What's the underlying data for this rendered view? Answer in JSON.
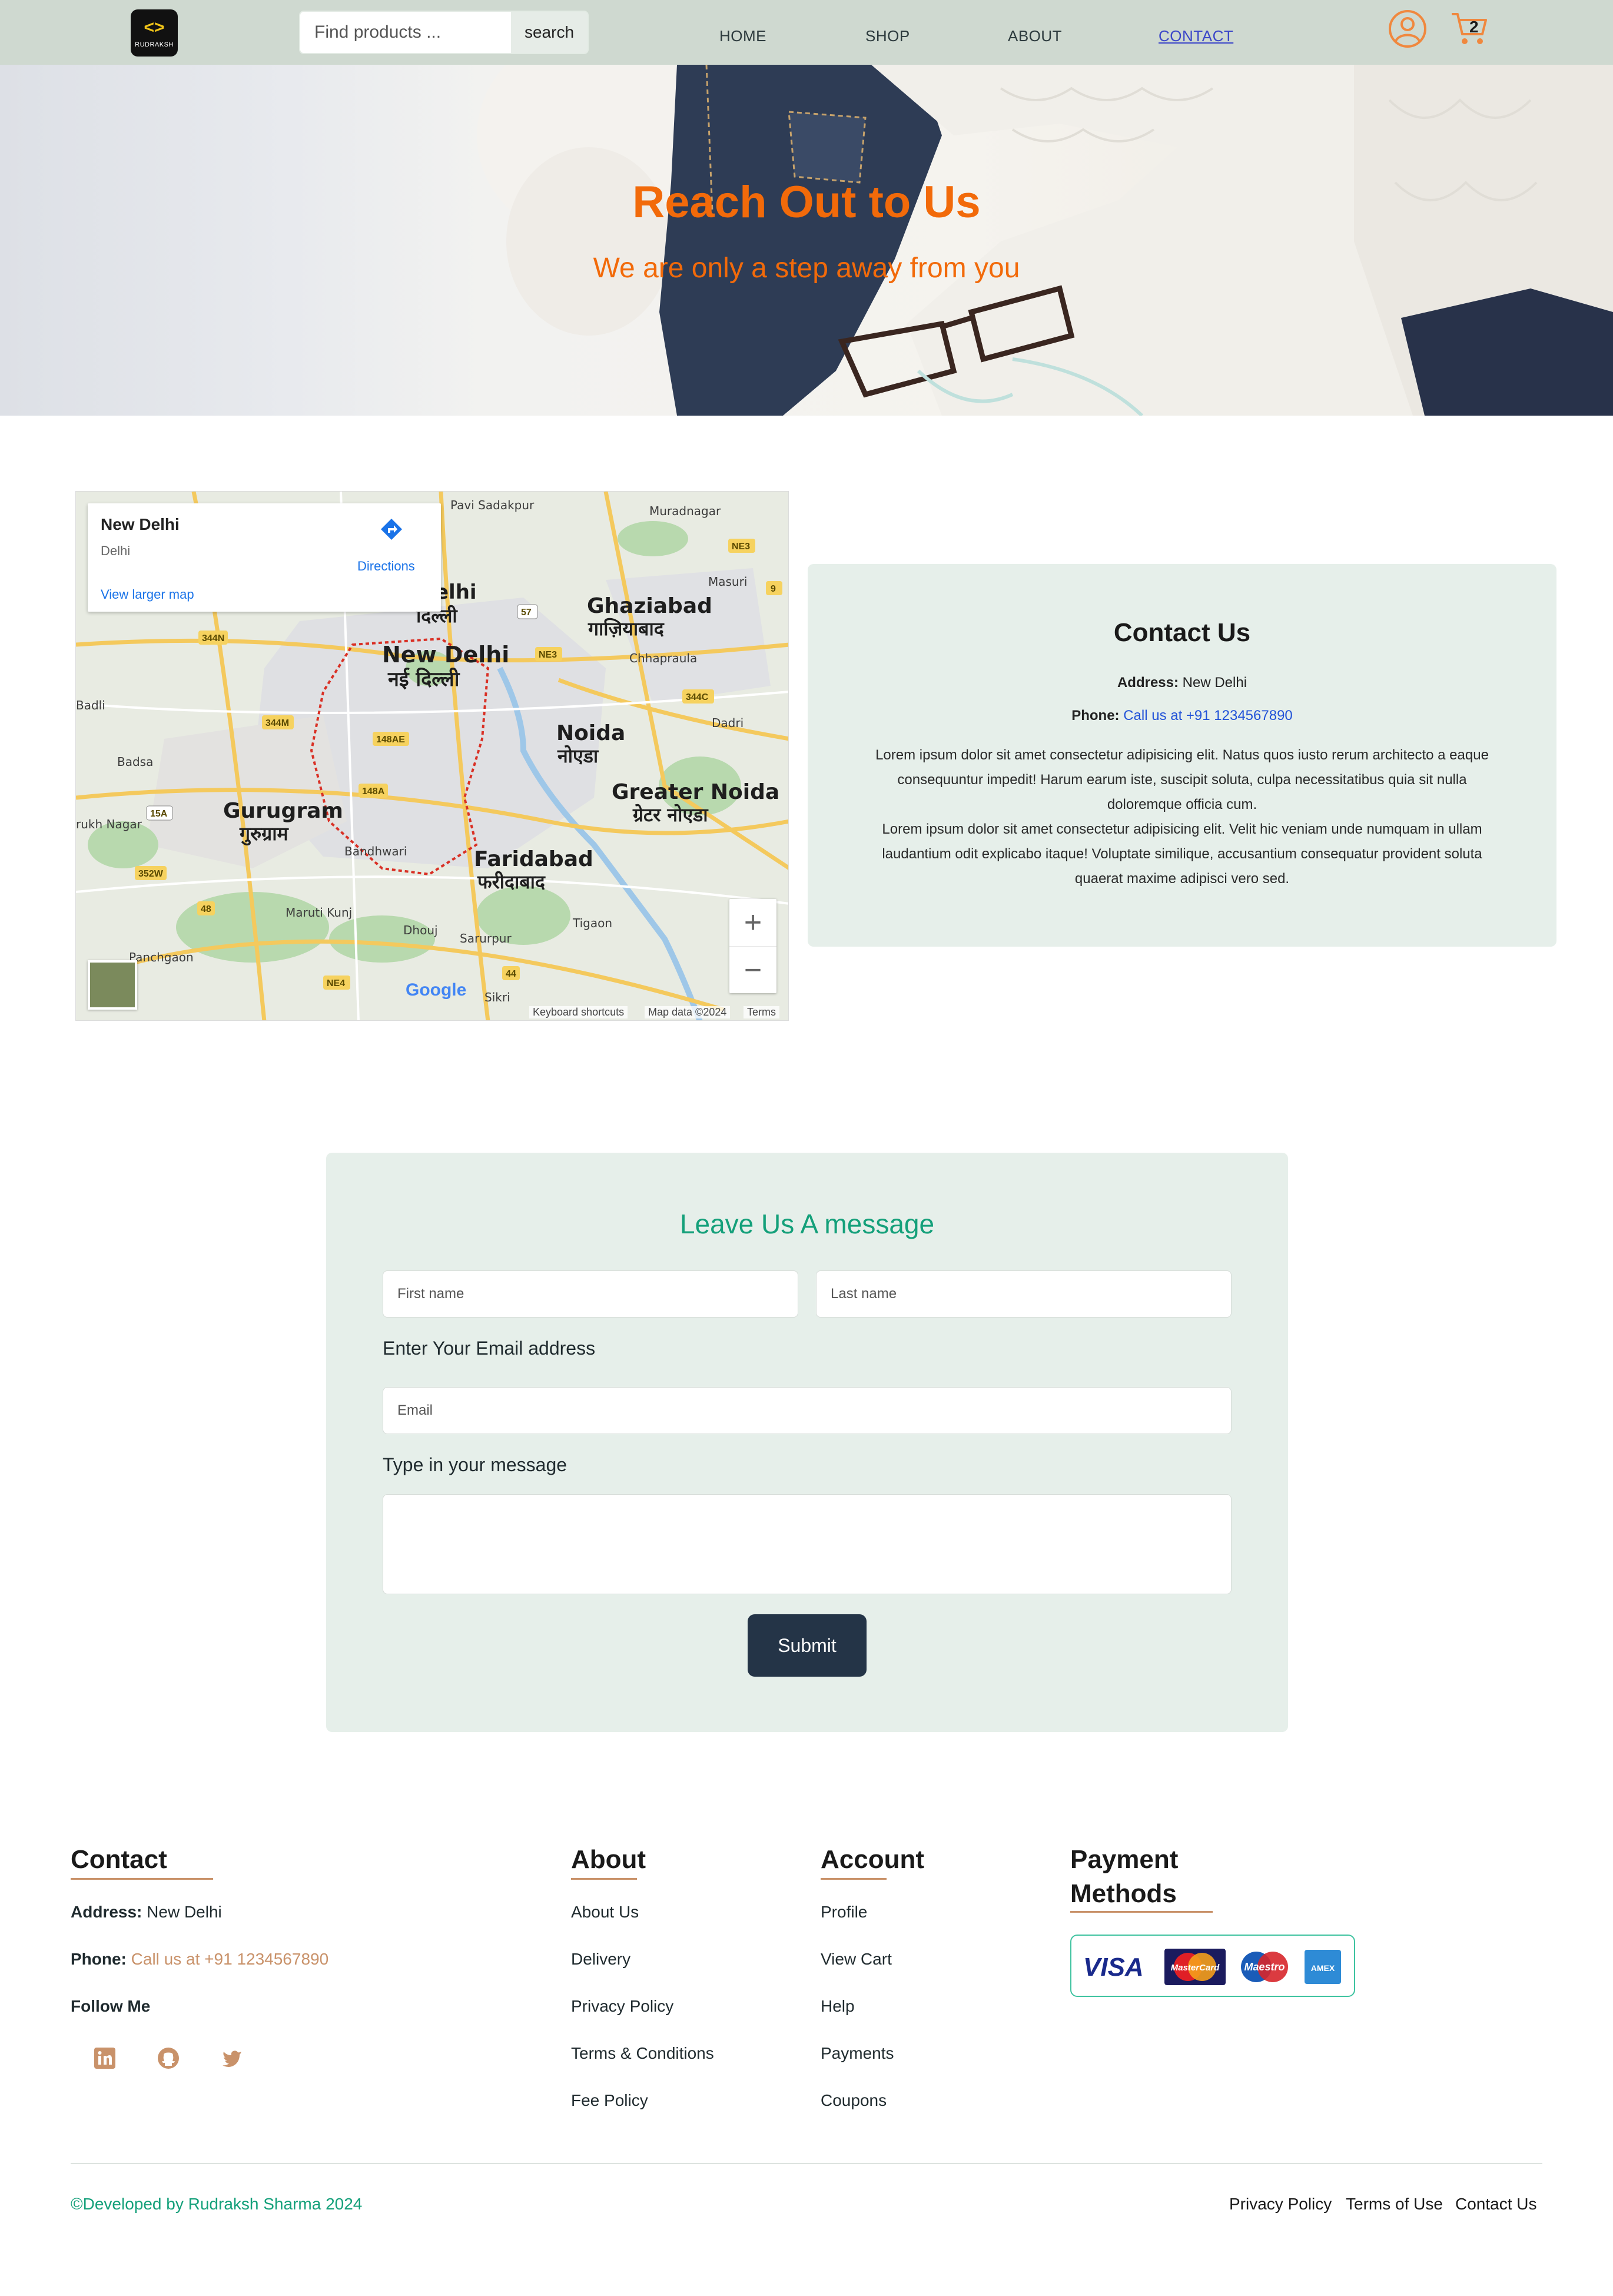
{
  "brand": {
    "logo_glyph": "<>",
    "logo_text": "RUDRAKSH"
  },
  "search": {
    "placeholder": "Find products ...",
    "button_label": "search"
  },
  "nav": {
    "items": [
      {
        "label": "HOME"
      },
      {
        "label": "SHOP"
      },
      {
        "label": "ABOUT"
      },
      {
        "label": "CONTACT",
        "active": true
      }
    ],
    "cart_count": "2"
  },
  "hero": {
    "title": "Reach Out to Us",
    "subtitle": "We are only a step away from you"
  },
  "map": {
    "place_name": "New Delhi",
    "place_sub": "Delhi",
    "directions_label": "Directions",
    "view_larger_label": "View larger map",
    "zoom_in": "+",
    "zoom_out": "−",
    "google_label": "Google",
    "footer": {
      "shortcuts": "Keyboard shortcuts",
      "map_data": "Map data ©2024",
      "terms": "Terms"
    },
    "labels": {
      "delhi": "New Delhi",
      "delhi_hi": "नई दिल्ली",
      "ghaziabad": "Ghaziabad",
      "ghaziabad_hi": "गाज़ियाबाद",
      "noida": "Noida",
      "noida_hi": "नोएडा",
      "greater_noida": "Greater Noida",
      "greater_noida_hi": "ग्रेटर नोएडा",
      "gurugram": "Gurugram",
      "gurugram_hi": "गुरुग्राम",
      "faridabad": "Faridabad",
      "faridabad_hi": "फरीदाबाद",
      "pavi_sadakpur": "Pavi Sadakpur",
      "muradnagar": "Muradnagar",
      "masuri": "Masuri",
      "chhapraula": "Chhapraula",
      "dadri": "Dadri",
      "badli": "Badli",
      "badsa": "Badsa",
      "rukh_nagar": "rukh Nagar",
      "bandhwari": "Bandhwari",
      "maruti_kunj": "Maruti Kunj",
      "dhouj": "Dhouj",
      "sarurpur": "Sarurpur",
      "tigaon": "Tigaon",
      "sikri": "Sikri",
      "panchgaon": "Panchgaon",
      "delhi_top": "elhi",
      "delhi_top_hi": "दिल्ली"
    },
    "road_badges": [
      "344N",
      "NE3",
      "57",
      "NE3",
      "9",
      "344M",
      "148AE",
      "148A",
      "15A",
      "352W",
      "48",
      "344C",
      "NE4",
      "44"
    ]
  },
  "contact_card": {
    "title": "Contact Us",
    "address_label": "Address:",
    "address_value": "New Delhi",
    "phone_label": "Phone:",
    "phone_value": "Call us at +91 1234567890",
    "body_1": "Lorem ipsum dolor sit amet consectetur adipisicing elit. Natus quos iusto rerum architecto a eaque consequuntur impedit! Harum earum iste, suscipit soluta, culpa necessitatibus quia sit nulla doloremque officia cum.",
    "body_2": "Lorem ipsum dolor sit amet consectetur adipisicing elit. Velit hic veniam unde numquam in ullam laudantium odit explicabo itaque! Voluptate similique, accusantium consequatur provident soluta quaerat maxime adipisci vero sed."
  },
  "message_form": {
    "title": "Leave Us A message",
    "first_name_placeholder": "First name",
    "last_name_placeholder": "Last name",
    "email_label": "Enter Your Email address",
    "email_placeholder": "Email",
    "message_label": "Type in your message",
    "submit_label": "Submit"
  },
  "footer": {
    "contact": {
      "title": "Contact",
      "address_label": "Address:",
      "address_value": "New Delhi",
      "phone_label": "Phone:",
      "phone_value": "Call us at +91 1234567890",
      "follow_label": "Follow Me"
    },
    "about": {
      "title": "About",
      "links": [
        "About Us",
        "Delivery",
        "Privacy Policy",
        "Terms & Conditions",
        "Fee Policy"
      ]
    },
    "account": {
      "title": "Account",
      "links": [
        "Profile",
        "View Cart",
        "Help",
        "Payments",
        "Coupons"
      ]
    },
    "payment": {
      "title_line1": "Payment",
      "title_line2": "Methods",
      "cards": [
        "VISA",
        "MasterCard",
        "Maestro",
        "AMEX"
      ]
    },
    "credit": "©Developed by Rudraksh Sharma 2024",
    "bottom_links": [
      "Privacy Policy",
      "Terms of Use",
      "Contact Us"
    ]
  },
  "colors": {
    "nav_bg": "#cfd9d0",
    "accent_orange": "#f26a0a",
    "card_bg": "#e6efea",
    "teal": "#14a07a",
    "tan": "#c9926a",
    "submit_bg": "#243447",
    "link_blue": "#2253d8"
  }
}
